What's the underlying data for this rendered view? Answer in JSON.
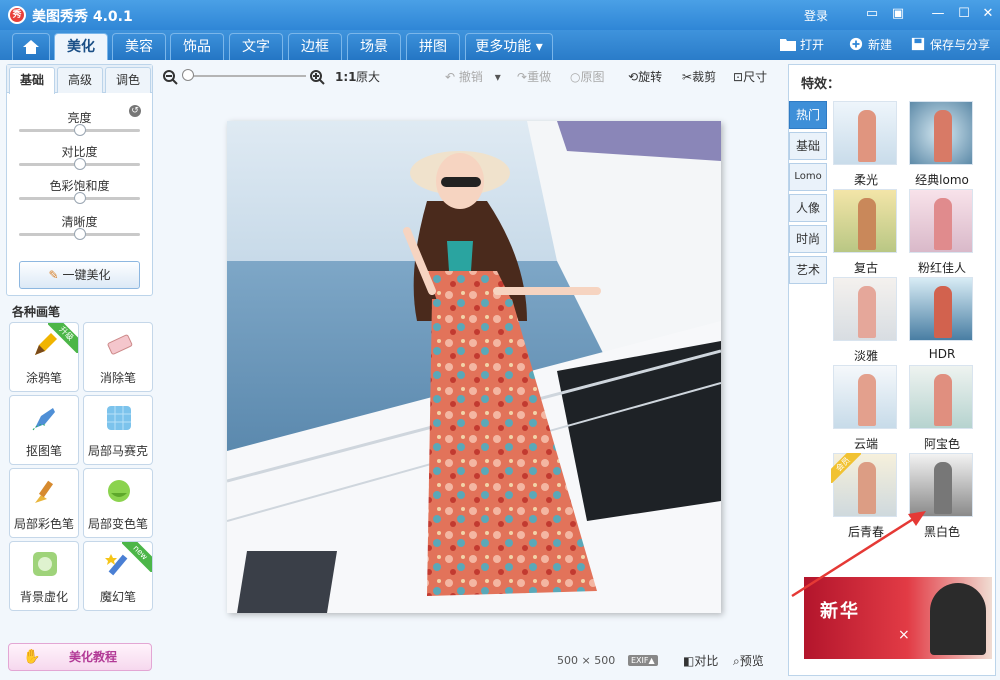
{
  "app": {
    "logo": "秀",
    "title": "美图秀秀 4.0.1",
    "login": "登录"
  },
  "tabs": [
    {
      "label": "美化"
    },
    {
      "label": "美容"
    },
    {
      "label": "饰品"
    },
    {
      "label": "文字"
    },
    {
      "label": "边框"
    },
    {
      "label": "场景"
    },
    {
      "label": "拼图"
    },
    {
      "label": "更多功能 ▾"
    }
  ],
  "topActions": {
    "open": "打开",
    "new": "新建",
    "save": "保存与分享"
  },
  "leftTabs": [
    "基础",
    "高级",
    "调色"
  ],
  "sliders": [
    {
      "label": "亮度",
      "value": 0.5
    },
    {
      "label": "对比度",
      "value": 0.5
    },
    {
      "label": "色彩饱和度",
      "value": 0.5
    },
    {
      "label": "清晰度",
      "value": 0.5
    }
  ],
  "oneClick": "一键美化",
  "brushSection": "各种画笔",
  "brushes": [
    {
      "label": "涂鸦笔",
      "icon": "pencil-icon",
      "tag": "升级"
    },
    {
      "label": "消除笔",
      "icon": "eraser-icon"
    },
    {
      "label": "抠图笔",
      "icon": "cutout-pen-icon"
    },
    {
      "label": "局部马赛克",
      "icon": "mosaic-icon"
    },
    {
      "label": "局部彩色笔",
      "icon": "color-brush-icon"
    },
    {
      "label": "局部变色笔",
      "icon": "recolor-brush-icon"
    },
    {
      "label": "背景虚化",
      "icon": "blur-icon"
    },
    {
      "label": "魔幻笔",
      "icon": "magic-pen-icon",
      "tag": "new"
    }
  ],
  "tutorial": "美化教程",
  "toolbar": {
    "ratio": "1:1",
    "original": "原大",
    "undo": "撤销",
    "redo": "重做",
    "source": "原图",
    "rotate": "旋转",
    "crop": "裁剪",
    "size": "尺寸"
  },
  "image": {
    "width": "500",
    "times": "×",
    "height": "500",
    "exif": "EXIF▲",
    "compare": "对比",
    "preview": "预览"
  },
  "effects": {
    "title": "特效：",
    "categories": [
      "热门",
      "基础",
      "Lomo",
      "人像",
      "时尚",
      "艺术"
    ],
    "items": [
      {
        "label": "柔光"
      },
      {
        "label": "经典lomo"
      },
      {
        "label": "复古"
      },
      {
        "label": "粉红佳人"
      },
      {
        "label": "淡雅"
      },
      {
        "label": "HDR"
      },
      {
        "label": "云端"
      },
      {
        "label": "阿宝色"
      },
      {
        "label": "后青春",
        "tag": "会员"
      },
      {
        "label": "黑白色"
      }
    ]
  },
  "ad": {
    "text": "新华",
    "close": "×"
  },
  "colors": {
    "titlebar": "#2f86d6",
    "activeCategory": "#3e8fd8",
    "arrow": "#e53935"
  }
}
